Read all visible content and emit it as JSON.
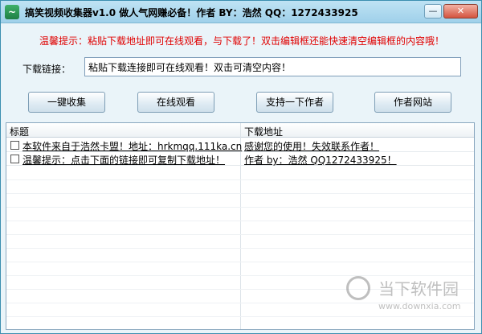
{
  "window": {
    "title": "搞笑视频收集器v1.0   做人气网赚必备！作者  BY：浩然   QQ：1272433925",
    "icon": "app-logo-icon",
    "minimize_glyph": "—",
    "close_glyph": "✕"
  },
  "warning_text": "温馨提示：粘贴下载地址即可在线观看，与下载了！双击编辑框还能快速清空编辑框的内容哦！",
  "download": {
    "label": "下载链接：",
    "value": "粘贴下载连接即可在线观看！双击可清空内容！"
  },
  "buttons": {
    "collect": "一键收集",
    "watch_online": "在线观看",
    "support_author": "支持一下作者",
    "author_site": "作者网站"
  },
  "list": {
    "columns": [
      "标题",
      "下载地址"
    ],
    "rows": [
      {
        "title": "本软件来自于浩然卡盟！地址：hrkmqq.111ka.cn",
        "url": "感谢您的使用！失效联系作者！"
      },
      {
        "title": "温馨提示：点击下面的链接即可复制下载地址！",
        "url": "作者 by：浩然  QQ1272433925！"
      }
    ]
  },
  "watermark": {
    "name": "当下软件园",
    "url": "www.downxia.com"
  },
  "colors": {
    "warning": "#e00000",
    "titlebar": "#9fd0ea",
    "window_bg": "#eaf4f9"
  }
}
